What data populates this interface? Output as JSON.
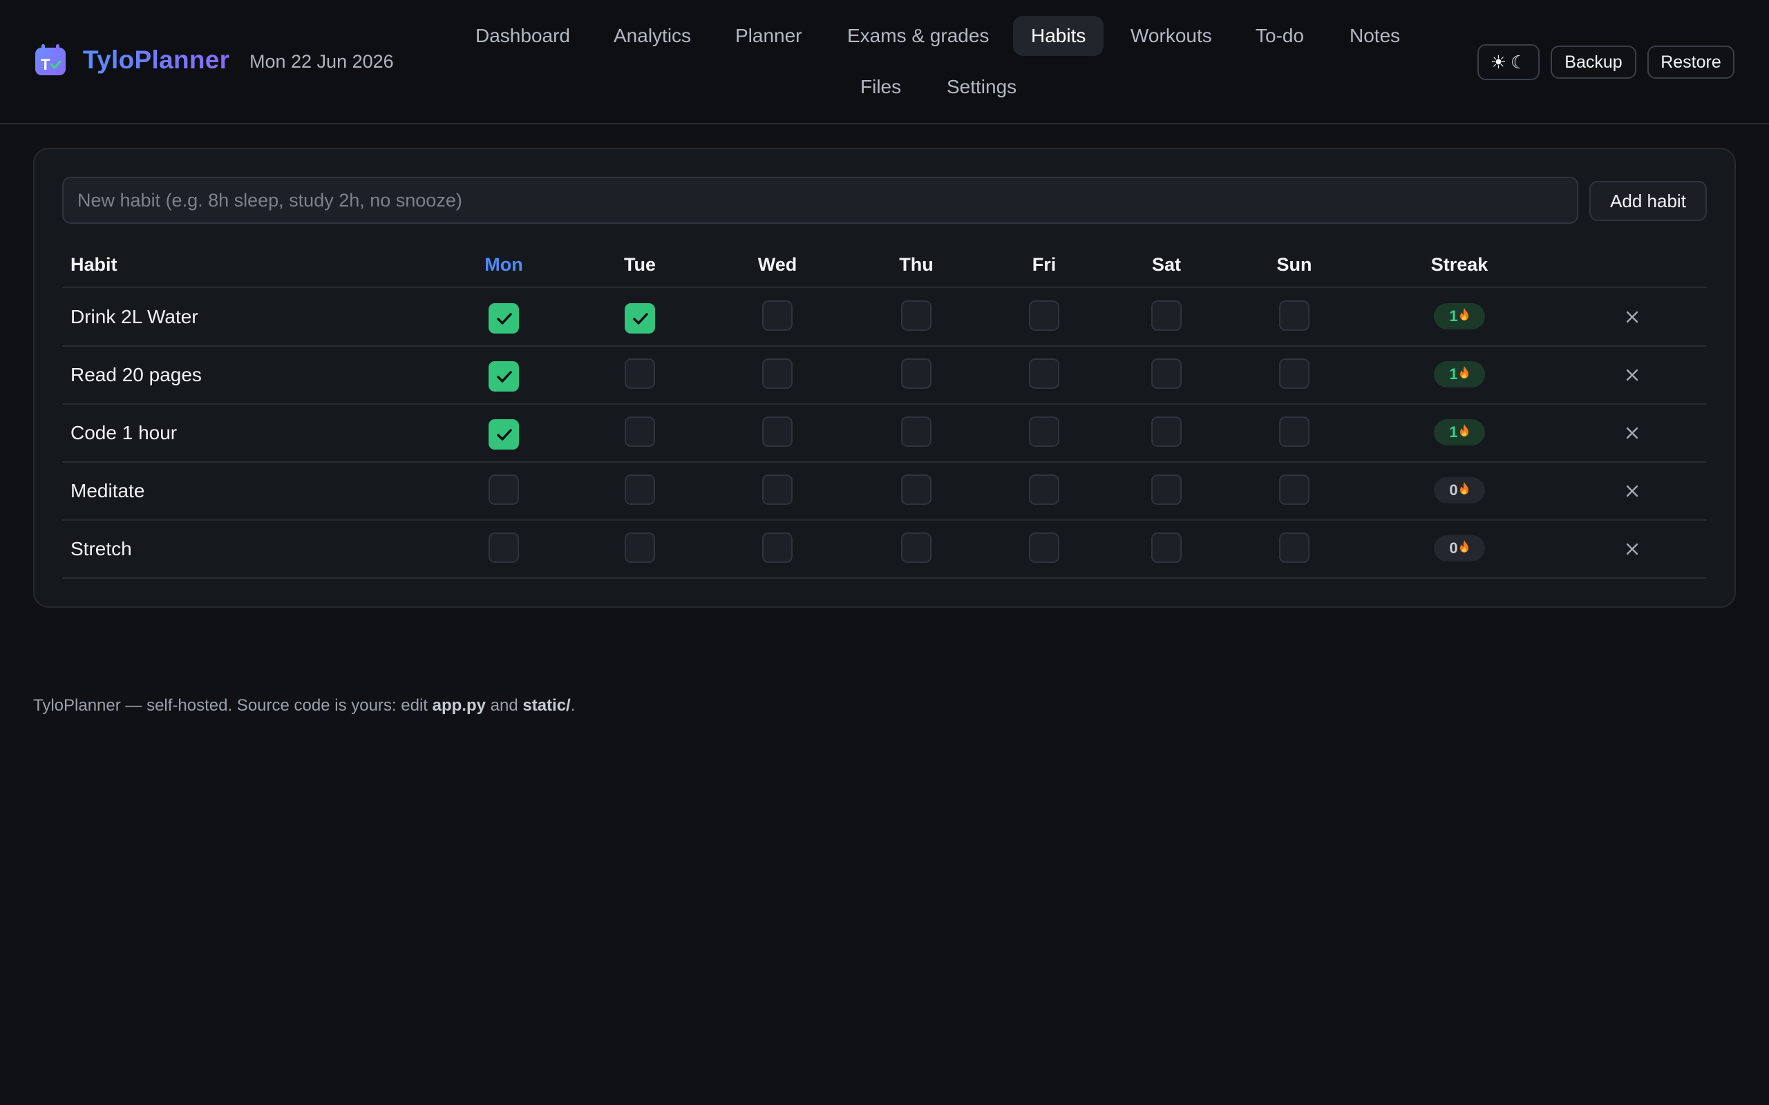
{
  "brand": {
    "name": "TyloPlanner",
    "date": "Mon 22 Jun 2026"
  },
  "nav": {
    "row1": [
      "Dashboard",
      "Analytics",
      "Planner",
      "Exams & grades",
      "Habits",
      "Workouts",
      "To-do",
      "Notes"
    ],
    "row2": [
      "Files",
      "Settings"
    ],
    "active": "Habits"
  },
  "header": {
    "theme_sun": "☀",
    "theme_moon": "☾",
    "backup_label": "Backup",
    "restore_label": "Restore"
  },
  "habit_form": {
    "placeholder": "New habit (e.g. 8h sleep, study 2h, no snooze)",
    "value": "",
    "add_label": "Add habit"
  },
  "table": {
    "headers": [
      "Habit",
      "Mon",
      "Tue",
      "Wed",
      "Thu",
      "Fri",
      "Sat",
      "Sun",
      "Streak"
    ],
    "today": "Mon",
    "rows": [
      {
        "name": "Drink 2L Water",
        "days": [
          true,
          true,
          false,
          false,
          false,
          false,
          false
        ],
        "streak": "1"
      },
      {
        "name": "Read 20 pages",
        "days": [
          true,
          false,
          false,
          false,
          false,
          false,
          false
        ],
        "streak": "1"
      },
      {
        "name": "Code 1 hour",
        "days": [
          true,
          false,
          false,
          false,
          false,
          false,
          false
        ],
        "streak": "1"
      },
      {
        "name": "Meditate",
        "days": [
          false,
          false,
          false,
          false,
          false,
          false,
          false
        ],
        "streak": "0"
      },
      {
        "name": "Stretch",
        "days": [
          false,
          false,
          false,
          false,
          false,
          false,
          false
        ],
        "streak": "0"
      }
    ]
  },
  "footer": {
    "text_a": "TyloPlanner — self-hosted. Source code is yours: edit ",
    "file_a": "app.py",
    "text_b": " and ",
    "file_b": "static/",
    "text_c": "."
  },
  "colors": {
    "accent": "#4f8bff",
    "check_green": "#34c37a",
    "background": "#0f1115",
    "card": "#15181d"
  },
  "icons": {
    "logo": "calendar-check-icon",
    "check": "checkmark-icon",
    "streak": "flame-icon",
    "delete": "close-icon"
  }
}
